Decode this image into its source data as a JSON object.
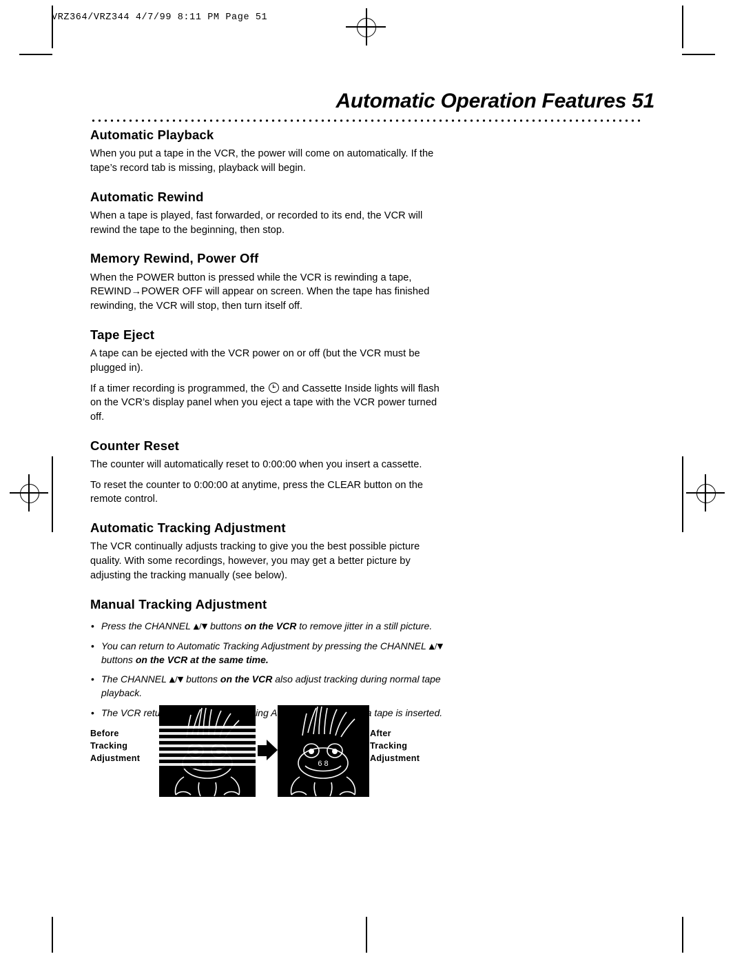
{
  "header_stamp": "VRZ364/VRZ344  4/7/99 8:11 PM  Page 51",
  "page_title": "Automatic Operation Features  51",
  "sections": [
    {
      "heading": "Automatic Playback",
      "paragraphs": [
        "When you put a tape in the VCR, the power will come on automatically. If the tape’s record tab is missing, playback will begin."
      ]
    },
    {
      "heading": "Automatic Rewind",
      "paragraphs": [
        "When a tape is played, fast forwarded, or recorded to its end, the VCR will rewind the tape to the beginning, then stop."
      ]
    },
    {
      "heading": "Memory Rewind, Power Off",
      "paragraphs": [
        "When the POWER button is pressed while the VCR is rewinding a tape, REWIND→POWER OFF will appear on screen. When the tape has finished rewinding, the VCR will stop, then turn itself off."
      ]
    },
    {
      "heading": "Tape Eject",
      "paragraphs": [
        "A tape can be ejected with the VCR power on or off (but the VCR must be plugged in).",
        "If a timer recording is programmed, the ⏱ and Cassette Inside lights will flash on the VCR’s display panel when you eject a tape with the VCR power turned off."
      ]
    },
    {
      "heading": "Counter Reset",
      "paragraphs": [
        "The counter will automatically reset to 0:00:00 when you insert a cassette.",
        "To reset the counter to 0:00:00 at anytime, press the CLEAR button on the remote control."
      ]
    },
    {
      "heading": "Automatic Tracking Adjustment",
      "paragraphs": [
        "The VCR continually adjusts tracking to give you the best possible picture quality. With some recordings, however, you may get a better picture by adjusting the tracking manually (see below)."
      ]
    }
  ],
  "manual_tracking": {
    "heading": "Manual Tracking Adjustment",
    "notes": [
      {
        "bullet": "•",
        "text_a": "Press the CHANNEL ",
        "tri": "▲/▼",
        "text_b": " buttons ",
        "bold": "on the VCR",
        "text_c": " to remove jitter in a still picture."
      },
      {
        "bullet": "•",
        "text_a": "You can return to Automatic Tracking Adjustment by pressing the CHANNEL ",
        "tri": "▲/▼",
        "text_b": " buttons ",
        "bold": "on the VCR at the same time.",
        "text_c": ""
      },
      {
        "bullet": "•",
        "text_a": "The CHANNEL ",
        "tri": "▲/▼",
        "text_b": " buttons ",
        "bold": "on the VCR",
        "text_c": " also adjust tracking during normal tape playback."
      },
      {
        "bullet": "•",
        "text_a": "The VCR returns to Automatic Tracking Adjustment whenever a tape is inserted.",
        "tri": "",
        "text_b": "",
        "bold": "",
        "text_c": ""
      }
    ]
  },
  "figure": {
    "before_label_lines": [
      "Before",
      "Tracking",
      "Adjustment"
    ],
    "after_label_lines": [
      "After",
      "Tracking",
      "Adjustment"
    ],
    "before_label": "Before\nTracking\nAdjustment",
    "after_label": "After\nTracking\nAdjustment",
    "screen_counter": "6 8"
  }
}
